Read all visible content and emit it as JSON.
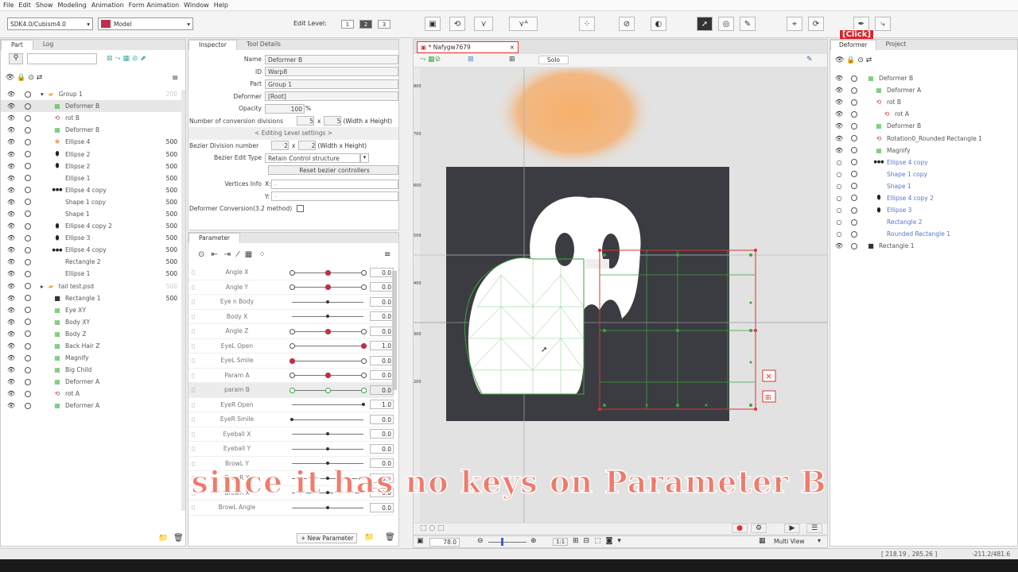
{
  "menu": [
    "File",
    "Edit",
    "Show",
    "Modeling",
    "Animation",
    "Form Animation",
    "Window",
    "Help"
  ],
  "toolbar": {
    "sdk": "SDK4.0/Cubism4.0",
    "mode": "Model",
    "edit_level_label": "Edit Level:",
    "levels": [
      "1",
      "2",
      "3"
    ],
    "click_badge": "[Click]"
  },
  "left": {
    "tabs": [
      "Part",
      "Log"
    ],
    "rows": [
      {
        "name": "Group 1",
        "val": "200",
        "kind": "folder",
        "indent": 0,
        "hl": false
      },
      {
        "name": "Deformer B",
        "val": "",
        "kind": "warp",
        "indent": 1,
        "hl": true
      },
      {
        "name": "rot B",
        "val": "",
        "kind": "rot",
        "indent": 1,
        "hl": false
      },
      {
        "name": "Deformer B",
        "val": "",
        "kind": "warp",
        "indent": 1,
        "hl": false
      },
      {
        "name": "Ellipse 4",
        "val": "500",
        "kind": "blur",
        "indent": 1,
        "hl": false
      },
      {
        "name": "Ellipse 2",
        "val": "500",
        "kind": "dot",
        "indent": 1,
        "hl": false
      },
      {
        "name": "Ellipse 2",
        "val": "500",
        "kind": "dot",
        "indent": 1,
        "hl": false
      },
      {
        "name": "Ellipse 1",
        "val": "500",
        "kind": "none",
        "indent": 1,
        "hl": false
      },
      {
        "name": "Ellipse 4 copy",
        "val": "500",
        "kind": "dots",
        "indent": 1,
        "hl": false
      },
      {
        "name": "Shape 1 copy",
        "val": "500",
        "kind": "none",
        "indent": 1,
        "hl": false
      },
      {
        "name": "Shape 1",
        "val": "500",
        "kind": "none",
        "indent": 1,
        "hl": false
      },
      {
        "name": "Ellipse 4 copy 2",
        "val": "500",
        "kind": "dot",
        "indent": 1,
        "hl": false
      },
      {
        "name": "Ellipse 3",
        "val": "500",
        "kind": "dot",
        "indent": 1,
        "hl": false
      },
      {
        "name": "Ellipse 4 copy",
        "val": "500",
        "kind": "dots",
        "indent": 1,
        "hl": false
      },
      {
        "name": "Rectangle 2",
        "val": "500",
        "kind": "none",
        "indent": 1,
        "hl": false
      },
      {
        "name": "Ellipse 1",
        "val": "500",
        "kind": "none",
        "indent": 1,
        "hl": false
      },
      {
        "name": "tail test.psd",
        "val": "500",
        "kind": "folder",
        "indent": 0,
        "hl": false
      },
      {
        "name": "Rectangle 1",
        "val": "500",
        "kind": "rect",
        "indent": 1,
        "hl": false
      },
      {
        "name": "Eye XY",
        "val": "",
        "kind": "warp",
        "indent": 1,
        "hl": false
      },
      {
        "name": "Body XY",
        "val": "",
        "kind": "warp",
        "indent": 1,
        "hl": false
      },
      {
        "name": "Body Z",
        "val": "",
        "kind": "warp",
        "indent": 1,
        "hl": false
      },
      {
        "name": "Back Hair Z",
        "val": "",
        "kind": "warp",
        "indent": 1,
        "hl": false
      },
      {
        "name": "Magnify",
        "val": "",
        "kind": "warp",
        "indent": 1,
        "hl": false
      },
      {
        "name": "Big Child",
        "val": "",
        "kind": "warp",
        "indent": 1,
        "hl": false
      },
      {
        "name": "Deformer A",
        "val": "",
        "kind": "warp",
        "indent": 1,
        "hl": false
      },
      {
        "name": "rot A",
        "val": "",
        "kind": "rot",
        "indent": 1,
        "hl": false
      },
      {
        "name": "Deformer A",
        "val": "",
        "kind": "warp",
        "indent": 1,
        "hl": false
      }
    ]
  },
  "inspector": {
    "tabs": [
      "Inspector",
      "Tool Details"
    ],
    "name_label": "Name",
    "name": "Deformer B",
    "id_label": "ID",
    "id": "Warp8",
    "part_label": "Part",
    "part": "Group 1",
    "deformer_label": "Deformer",
    "deformer": "[Root]",
    "opacity_label": "Opacity",
    "opacity": "100",
    "opacity_unit": "%",
    "conv_label": "Number of conversion divisions",
    "conv_a": "5",
    "conv_b": "5",
    "conv_x": "x",
    "conv_wh": "(Width x Height)",
    "editing_level": "< Editing Level settings >",
    "bez_label": "Bezier Division number",
    "bez_a": "2",
    "bez_b": "2",
    "bez_wh": "(Width x Height)",
    "bez_type_label": "Bezier Edit Type",
    "bez_type": "Retain Control structure",
    "reset": "Reset bezier controllers",
    "vert_label": "Vertices Info",
    "vx": "X:",
    "vy": "Y:",
    "vdash": "-",
    "conv32": "Deformer Conversion(3.2 method)"
  },
  "params": {
    "tab": "Parameter",
    "new_param": "New Parameter",
    "rows": [
      {
        "name": "Angle X",
        "val": "0.0",
        "kind": "three",
        "keys": [
          0,
          50,
          100
        ],
        "red": 1,
        "pos": 50
      },
      {
        "name": "Angle Y",
        "val": "0.0",
        "kind": "three",
        "keys": [
          0,
          50,
          100
        ],
        "red": 1,
        "pos": 50
      },
      {
        "name": "Eye n Body",
        "val": "0.0",
        "kind": "dot",
        "pos": 50
      },
      {
        "name": "Body X",
        "val": "0.0",
        "kind": "dot",
        "pos": 50
      },
      {
        "name": "Angle Z",
        "val": "0.0",
        "kind": "three",
        "keys": [
          0,
          50,
          100
        ],
        "red": 1,
        "pos": 50
      },
      {
        "name": "EyeL Open",
        "val": "1.0",
        "kind": "two",
        "keys": [
          0,
          100
        ],
        "red": 1,
        "pos": 100
      },
      {
        "name": "EyeL Smile",
        "val": "0.0",
        "kind": "two",
        "keys": [
          0,
          100
        ],
        "red": 0,
        "pos": 0
      },
      {
        "name": "Param A",
        "val": "0.0",
        "kind": "three",
        "keys": [
          0,
          50,
          100
        ],
        "red": 1,
        "pos": 50
      },
      {
        "name": "param B",
        "val": "0.0",
        "kind": "green",
        "keys": [
          0,
          50,
          100
        ],
        "pos": 0
      },
      {
        "name": "EyeR Open",
        "val": "1.0",
        "kind": "dot",
        "pos": 100
      },
      {
        "name": "EyeR Smile",
        "val": "0.0",
        "kind": "dot",
        "pos": 0
      },
      {
        "name": "Eyeball X",
        "val": "0.0",
        "kind": "dot",
        "pos": 50
      },
      {
        "name": "Eyeball Y",
        "val": "0.0",
        "kind": "dot",
        "pos": 50
      },
      {
        "name": "BrowL Y",
        "val": "0.0",
        "kind": "dot",
        "pos": 50
      },
      {
        "name": "BrowR Y",
        "val": "0.0",
        "kind": "dot",
        "pos": 50
      },
      {
        "name": "BrowR X",
        "val": "0.0",
        "kind": "dot",
        "pos": 50
      },
      {
        "name": "BrowL Angle",
        "val": "0.0",
        "kind": "dot",
        "pos": 50
      }
    ]
  },
  "canvas": {
    "tab": "* Nafygw7679",
    "solo": "Solo",
    "zoom": "78.0",
    "ratio": "1:1",
    "multi_view": "Multi View",
    "ruler": [
      "800",
      "700",
      "600",
      "500",
      "400",
      "300",
      "200"
    ]
  },
  "right": {
    "tabs": [
      "Deformer",
      "Project"
    ],
    "rows": [
      {
        "name": "Deformer B",
        "kind": "warp",
        "indent": 0,
        "eye": true
      },
      {
        "name": "Deformer A",
        "kind": "warp",
        "indent": 1,
        "eye": true
      },
      {
        "name": "rot B",
        "kind": "rot",
        "indent": 1,
        "eye": true
      },
      {
        "name": "rot A",
        "kind": "rot",
        "indent": 2,
        "eye": true
      },
      {
        "name": "Deformer B",
        "kind": "warp",
        "indent": 1,
        "eye": true
      },
      {
        "name": "Rotation0_Rounded Rectangle 1",
        "kind": "rot",
        "indent": 1,
        "eye": true
      },
      {
        "name": "Magnify",
        "kind": "warp",
        "indent": 1,
        "eye": true
      },
      {
        "name": "Ellipse 4 copy",
        "kind": "dots",
        "indent": 1,
        "eye": false
      },
      {
        "name": "Shape 1 copy",
        "kind": "none",
        "indent": 1,
        "eye": false
      },
      {
        "name": "Shape 1",
        "kind": "none",
        "indent": 1,
        "eye": false
      },
      {
        "name": "Ellipse 4 copy 2",
        "kind": "dot",
        "indent": 1,
        "eye": false
      },
      {
        "name": "Ellipse 3",
        "kind": "dot",
        "indent": 1,
        "eye": false
      },
      {
        "name": "Rectangle 2",
        "kind": "none",
        "indent": 1,
        "eye": false
      },
      {
        "name": "Rounded Rectangle 1",
        "kind": "none",
        "indent": 1,
        "eye": false
      },
      {
        "name": "Rectangle 1",
        "kind": "rect",
        "indent": 0,
        "eye": true
      }
    ]
  },
  "status": {
    "coords": "[ 218.19 , 285.26 ]",
    "extra": "-211.2/481.6"
  },
  "caption": "since it has no keys on Parameter B",
  "colors": {
    "accent": "#c0304a",
    "mesh": "#3aa53a",
    "caption": "#f07b6b",
    "canvas_bg": "#3b3b42"
  }
}
